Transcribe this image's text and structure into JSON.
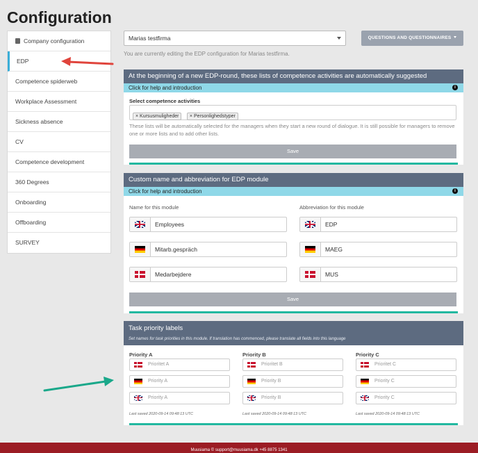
{
  "page": {
    "title": "Configuration"
  },
  "sidebar": {
    "items": [
      {
        "label": "Company configuration"
      },
      {
        "label": "EDP"
      },
      {
        "label": "Competence spiderweb"
      },
      {
        "label": "Workplace Assessment"
      },
      {
        "label": "Sickness absence"
      },
      {
        "label": "CV"
      },
      {
        "label": "Competence development"
      },
      {
        "label": "360 Degrees"
      },
      {
        "label": "Onboarding"
      },
      {
        "label": "Offboarding"
      },
      {
        "label": "SURVEY"
      }
    ]
  },
  "top": {
    "company_value": "Marias testfirma",
    "questions_button": "QUESTIONS AND QUESTIONNAIRES",
    "editing_note": "You are currently editing the EDP configuration for Marias testfirma."
  },
  "panel_activities": {
    "header": "At the beginning of a new EDP-round, these lists of competence activities are automatically suggested",
    "help": "Click for help and introduction",
    "label": "Select competence activities",
    "tags": [
      "× Kursusmuligheder",
      "× Personlighedstyper"
    ],
    "hint": "These lists will be automatically selected for the managers when they start a new round of dialogue. It is still possible for managers to remove one or more lists and to add other lists.",
    "save": "Save"
  },
  "panel_module_name": {
    "header": "Custom name and abbreviation for EDP module",
    "help": "Click for help and introduction",
    "name_heading": "Name for this module",
    "abbr_heading": "Abbreviation for this module",
    "names": [
      {
        "flag": "gb",
        "value": "Employees"
      },
      {
        "flag": "de",
        "value": "Mitarb.gespräch"
      },
      {
        "flag": "dk",
        "value": "Medarbejdere"
      }
    ],
    "abbreviations": [
      {
        "flag": "gb",
        "value": "EDP"
      },
      {
        "flag": "de",
        "value": "MAEG"
      },
      {
        "flag": "dk",
        "value": "MUS"
      }
    ],
    "save": "Save"
  },
  "panel_priority": {
    "header": "Task priority labels",
    "subheader": "Set names for task priorities in this module. If translation has commenced, please translate all fields into this language",
    "columns": [
      {
        "title": "Priority A",
        "fields": [
          {
            "flag": "dk",
            "placeholder": "Prioritet A"
          },
          {
            "flag": "de",
            "placeholder": "Priority A"
          },
          {
            "flag": "gb",
            "placeholder": "Priority A"
          }
        ],
        "saved": "Last saved 2020-09-14 09:48:13 UTC"
      },
      {
        "title": "Priority B",
        "fields": [
          {
            "flag": "dk",
            "placeholder": "Prioritet B"
          },
          {
            "flag": "de",
            "placeholder": "Priority B"
          },
          {
            "flag": "gb",
            "placeholder": "Priority B"
          }
        ],
        "saved": "Last saved 2020-09-14 09:48:13 UTC"
      },
      {
        "title": "Priority C",
        "fields": [
          {
            "flag": "dk",
            "placeholder": "Prioritet C"
          },
          {
            "flag": "de",
            "placeholder": "Priority C"
          },
          {
            "flag": "gb",
            "placeholder": "Priority C"
          }
        ],
        "saved": "Last saved 2020-09-14 09:48:13 UTC"
      }
    ]
  },
  "footer": {
    "text": "Muusiama ©  support@muusiama.dk  +45 8875 1341"
  },
  "colors": {
    "panel_header": "#5d6b80",
    "help_bar": "#8fd8e8",
    "accent_line": "#22b8a0",
    "red_arrow": "#e0443c",
    "green_arrow": "#1aa88a",
    "footer": "#9b1c24"
  }
}
